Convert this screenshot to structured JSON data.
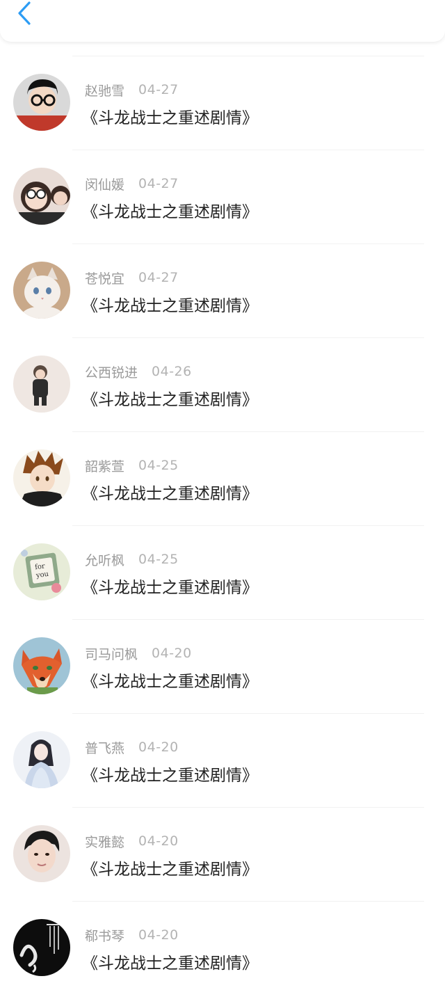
{
  "header": {
    "back_icon": "chevron-left-icon",
    "accent_color": "#2c9cf4"
  },
  "items": [
    {
      "name": "赵驰雪",
      "date": "04-27",
      "title": "《斗龙战士之重述剧情》",
      "avatar": "avatar-boy-glasses"
    },
    {
      "name": "闵仙媛",
      "date": "04-27",
      "title": "《斗龙战士之重述剧情》",
      "avatar": "avatar-girls-selfie"
    },
    {
      "name": "苍悦宜",
      "date": "04-27",
      "title": "《斗龙战士之重述剧情》",
      "avatar": "avatar-white-cat"
    },
    {
      "name": "公西锐进",
      "date": "04-26",
      "title": "《斗龙战士之重述剧情》",
      "avatar": "avatar-toddler"
    },
    {
      "name": "韶紫萱",
      "date": "04-25",
      "title": "《斗龙战士之重述剧情》",
      "avatar": "avatar-anime-boy"
    },
    {
      "name": "允听枫",
      "date": "04-25",
      "title": "《斗龙战士之重述剧情》",
      "avatar": "avatar-for-you-card"
    },
    {
      "name": "司马问枫",
      "date": "04-20",
      "title": "《斗龙战士之重述剧情》",
      "avatar": "avatar-fox"
    },
    {
      "name": "普飞燕",
      "date": "04-20",
      "title": "《斗龙战士之重述剧情》",
      "avatar": "avatar-ancient-lady"
    },
    {
      "name": "实雅懿",
      "date": "04-20",
      "title": "《斗龙战士之重述剧情》",
      "avatar": "avatar-young-man"
    },
    {
      "name": "郗书琴",
      "date": "04-20",
      "title": "《斗龙战士之重述剧情》",
      "avatar": "avatar-dark-calligraphy"
    }
  ]
}
